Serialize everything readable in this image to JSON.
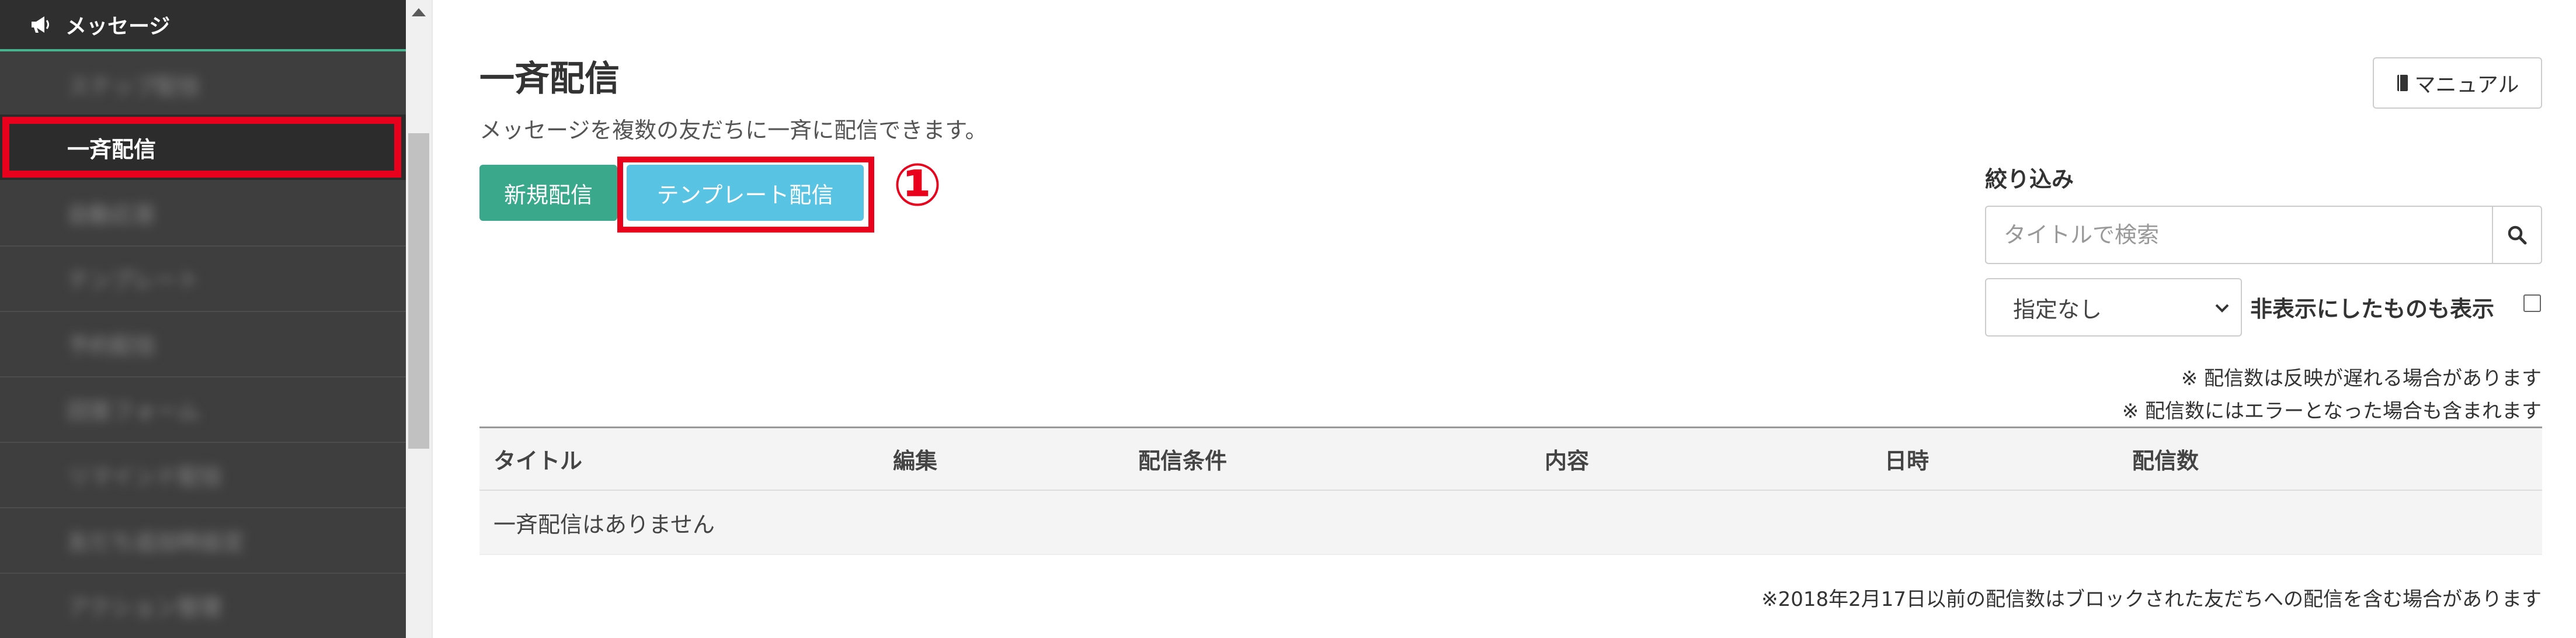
{
  "sidebar": {
    "header_label": "メッセージ",
    "items": [
      {
        "label": "ステップ配信",
        "blurred": true
      },
      {
        "label": "一斉配信",
        "blurred": false,
        "active": true
      },
      {
        "label": "自動応答",
        "blurred": true
      },
      {
        "label": "テンプレート",
        "blurred": true
      },
      {
        "label": "予約配信",
        "blurred": true
      },
      {
        "label": "回答フォーム",
        "blurred": true
      },
      {
        "label": "リマインド配信",
        "blurred": true
      },
      {
        "label": "友だち追加時設定",
        "blurred": true
      },
      {
        "label": "アクション管理",
        "blurred": true
      }
    ]
  },
  "main": {
    "title": "一斉配信",
    "description": "メッセージを複数の友だちに一斉に配信できます。",
    "new_button": "新規配信",
    "template_button": "テンプレート配信",
    "annotation_number": "①",
    "manual_button": "マニュアル",
    "filter": {
      "title": "絞り込み",
      "search_placeholder": "タイトルで検索",
      "search_value": "",
      "select_value": "指定なし",
      "hidden_label": "非表示にしたものも表示",
      "hidden_checked": false
    },
    "notes": [
      "※ 配信数は反映が遅れる場合があります",
      "※ 配信数にはエラーとなった場合も含まれます"
    ],
    "table": {
      "columns": [
        "タイトル",
        "編集",
        "配信条件",
        "内容",
        "日時",
        "配信数"
      ],
      "empty_message": "一斉配信はありません"
    },
    "footnote": "※2018年2月17日以前の配信数はブロックされた友だちへの配信を含む場合があります"
  },
  "colors": {
    "sidebar_bg": "#3e3e3e",
    "accent_green": "#3aa88a",
    "template_blue": "#58c3e3",
    "highlight_red": "#e8001c"
  }
}
